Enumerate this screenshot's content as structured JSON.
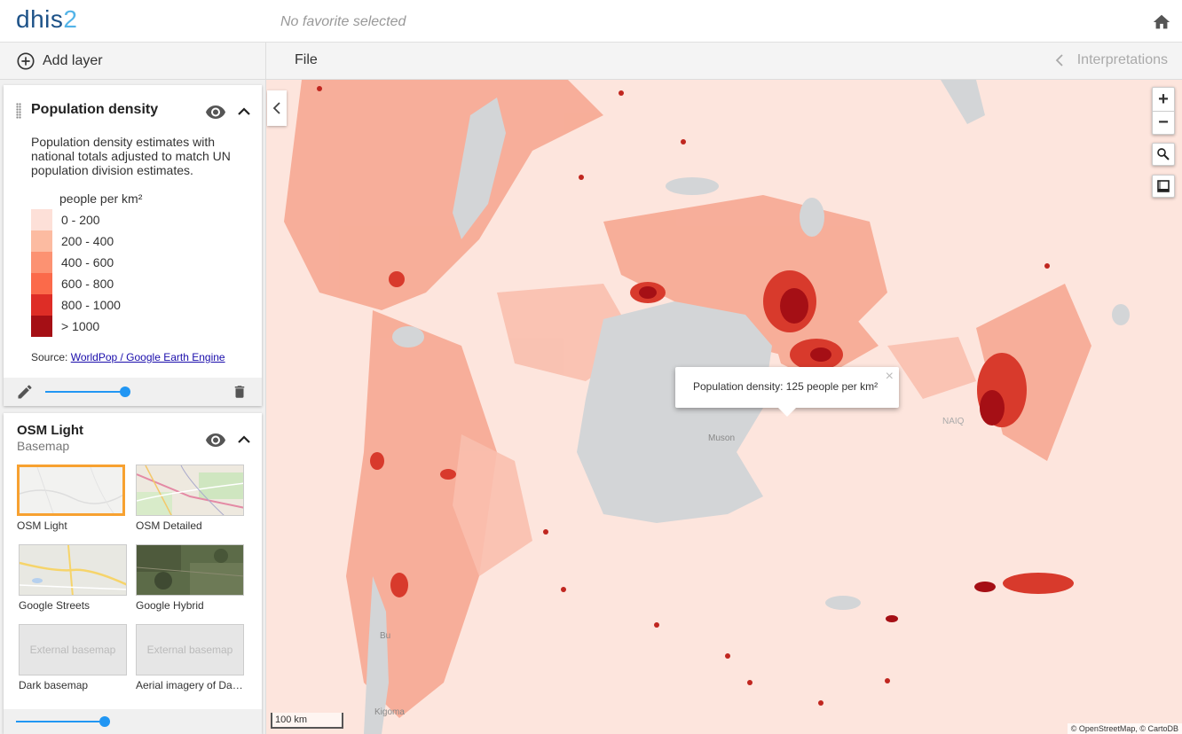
{
  "header": {
    "logo_main": "dhis",
    "logo_num": "2",
    "favorite": "No favorite selected"
  },
  "toolbar": {
    "add_layer": "Add layer",
    "file": "File",
    "interpretations": "Interpretations"
  },
  "layers": [
    {
      "title": "Population density",
      "description": "Population density estimates with national totals adjusted to match UN population division estimates.",
      "legend_title": "people per km²",
      "legend": [
        {
          "label": "0 - 200",
          "color": "#fde0d8"
        },
        {
          "label": "200 - 400",
          "color": "#fcbba1"
        },
        {
          "label": "400 - 600",
          "color": "#fc9272"
        },
        {
          "label": "600 - 800",
          "color": "#fb6a4a"
        },
        {
          "label": "800 - 1000",
          "color": "#de2d26"
        },
        {
          "label": "> 1000",
          "color": "#a50f15"
        }
      ],
      "source_prefix": "Source: ",
      "source_link": "WorldPop / Google Earth Engine",
      "opacity": 0.9
    }
  ],
  "basemap": {
    "title": "OSM Light",
    "subtitle": "Basemap",
    "options": [
      {
        "label": "OSM Light",
        "selected": true
      },
      {
        "label": "OSM Detailed",
        "selected": false
      },
      {
        "label": "Google Streets",
        "selected": false
      },
      {
        "label": "Google Hybrid",
        "selected": false
      },
      {
        "label": "Dark basemap",
        "selected": false,
        "placeholder": "External basemap"
      },
      {
        "label": "Aerial imagery of Dar...",
        "selected": false,
        "placeholder": "External basemap"
      }
    ],
    "opacity": 0.8
  },
  "map": {
    "popup": "Population density: 125 people per km²",
    "scale": "100 km",
    "attribution": "© OpenStreetMap, © CartoDB",
    "labels": {
      "muson": "Muson",
      "kigoma": "Kigoma",
      "bu": "Bu",
      "naiq": "NAIQ"
    }
  },
  "colors": {
    "accent": "#2196f3",
    "selected_border": "#f7a130",
    "map_base": "#fde5dd",
    "lake": "#d3d5d7"
  }
}
